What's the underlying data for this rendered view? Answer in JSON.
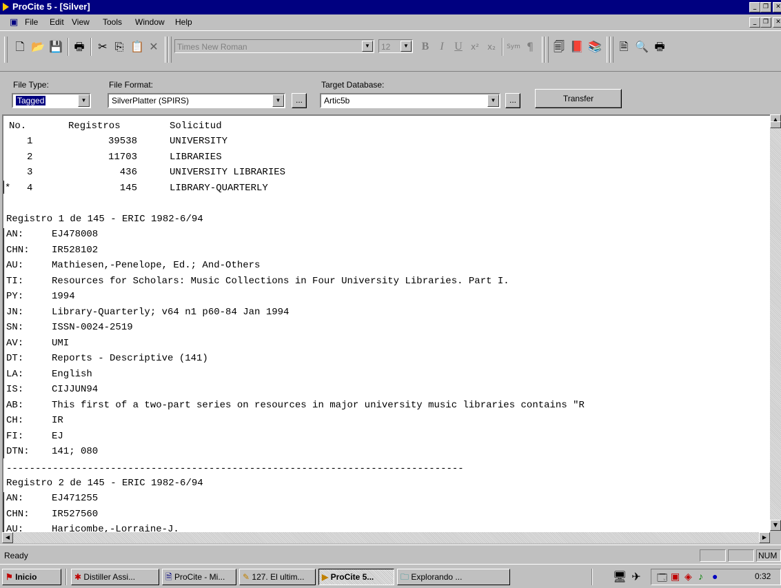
{
  "window": {
    "title": "ProCite 5 - [Silver]"
  },
  "menu": {
    "items": [
      "File",
      "Edit",
      "View",
      "Tools",
      "Window",
      "Help"
    ]
  },
  "toolbar": {
    "font": "Times New Roman",
    "size": "12",
    "sym": "Sym"
  },
  "transfer": {
    "file_type_label": "File Type:",
    "file_type_value": "Tagged",
    "file_format_label": "File Format:",
    "file_format_value": "SilverPlatter (SPIRS)",
    "target_db_label": "Target Database:",
    "target_db_value": "Artic5b",
    "browse": "...",
    "transfer_btn": "Transfer"
  },
  "search_history": {
    "headers": [
      "No.",
      "Registros",
      "Solicitud"
    ],
    "rows": [
      {
        "mark": "",
        "no": "1",
        "count": "39538",
        "query": "UNIVERSITY"
      },
      {
        "mark": "",
        "no": "2",
        "count": "11703",
        "query": "LIBRARIES"
      },
      {
        "mark": "",
        "no": "3",
        "count": "436",
        "query": "UNIVERSITY LIBRARIES"
      },
      {
        "mark": "*",
        "no": "4",
        "count": "145",
        "query": "LIBRARY-QUARTERLY"
      }
    ]
  },
  "record1": {
    "header": "Registro 1 de 145 - ERIC 1982-6/94",
    "fields": [
      {
        "tag": "AN:",
        "value": "EJ478008"
      },
      {
        "tag": "CHN:",
        "value": "IR528102"
      },
      {
        "tag": "AU:",
        "value": "Mathiesen,-Penelope, Ed.; And-Others"
      },
      {
        "tag": "TI:",
        "value": "Resources for Scholars: Music Collections in Four University Libraries. Part I."
      },
      {
        "tag": "PY:",
        "value": "1994"
      },
      {
        "tag": "JN:",
        "value": "Library-Quarterly; v64 n1 p60-84 Jan 1994"
      },
      {
        "tag": "SN:",
        "value": "ISSN-0024-2519"
      },
      {
        "tag": "AV:",
        "value": "UMI"
      },
      {
        "tag": "DT:",
        "value": "Reports - Descriptive (141)"
      },
      {
        "tag": "LA:",
        "value": "English"
      },
      {
        "tag": "IS:",
        "value": "CIJJUN94"
      },
      {
        "tag": "AB:",
        "value": "This first of a two-part series on resources in major university music libraries contains \"R"
      },
      {
        "tag": "CH:",
        "value": "IR"
      },
      {
        "tag": "FI:",
        "value": "EJ"
      },
      {
        "tag": "DTN:",
        "value": "141; 080"
      }
    ]
  },
  "separator": "-------------------------------------------------------------------------------",
  "record2": {
    "header": "Registro 2 de 145 - ERIC 1982-6/94",
    "fields": [
      {
        "tag": "AN:",
        "value": "EJ471255"
      },
      {
        "tag": "CHN:",
        "value": "IR527560"
      },
      {
        "tag": "AU:",
        "value": "Haricombe,-Lorraine-J."
      }
    ]
  },
  "status": {
    "text": "Ready",
    "num": "NUM"
  },
  "taskbar": {
    "start": "Inicio",
    "tasks": [
      "Distiller Assi...",
      "ProCite - Mi...",
      "127. El ultim...",
      "ProCite 5...",
      "Explorando ..."
    ],
    "clock": "0:32"
  }
}
